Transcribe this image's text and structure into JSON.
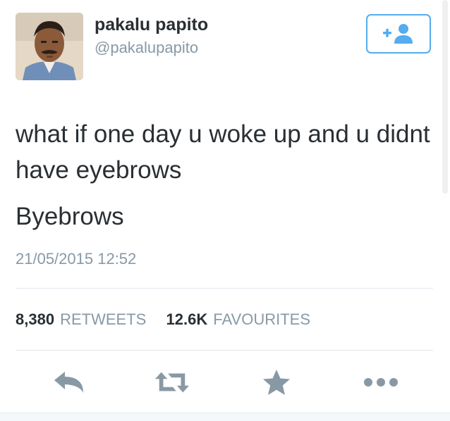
{
  "user": {
    "name": "pakalu papito",
    "handle": "@pakalupapito"
  },
  "follow_button": {
    "icon": "add-user-icon",
    "color": "#55acee"
  },
  "tweet": {
    "text": "what if one day u woke up and u didnt have eyebrows",
    "text_line2": "Byebrows",
    "timestamp": "21/05/2015 12:52"
  },
  "stats": {
    "retweets_count": "8,380",
    "retweets_label": "RETWEETS",
    "favourites_count": "12.6K",
    "favourites_label": "FAVOURITES"
  },
  "actions": [
    {
      "name": "reply",
      "icon": "reply-icon"
    },
    {
      "name": "retweet",
      "icon": "retweet-icon"
    },
    {
      "name": "favourite",
      "icon": "star-icon"
    },
    {
      "name": "more",
      "icon": "more-icon"
    }
  ],
  "colors": {
    "text": "#292f33",
    "secondary": "#8899a6",
    "accent": "#55acee",
    "divider": "#e1e8ed",
    "action_icon": "#8899a6"
  }
}
